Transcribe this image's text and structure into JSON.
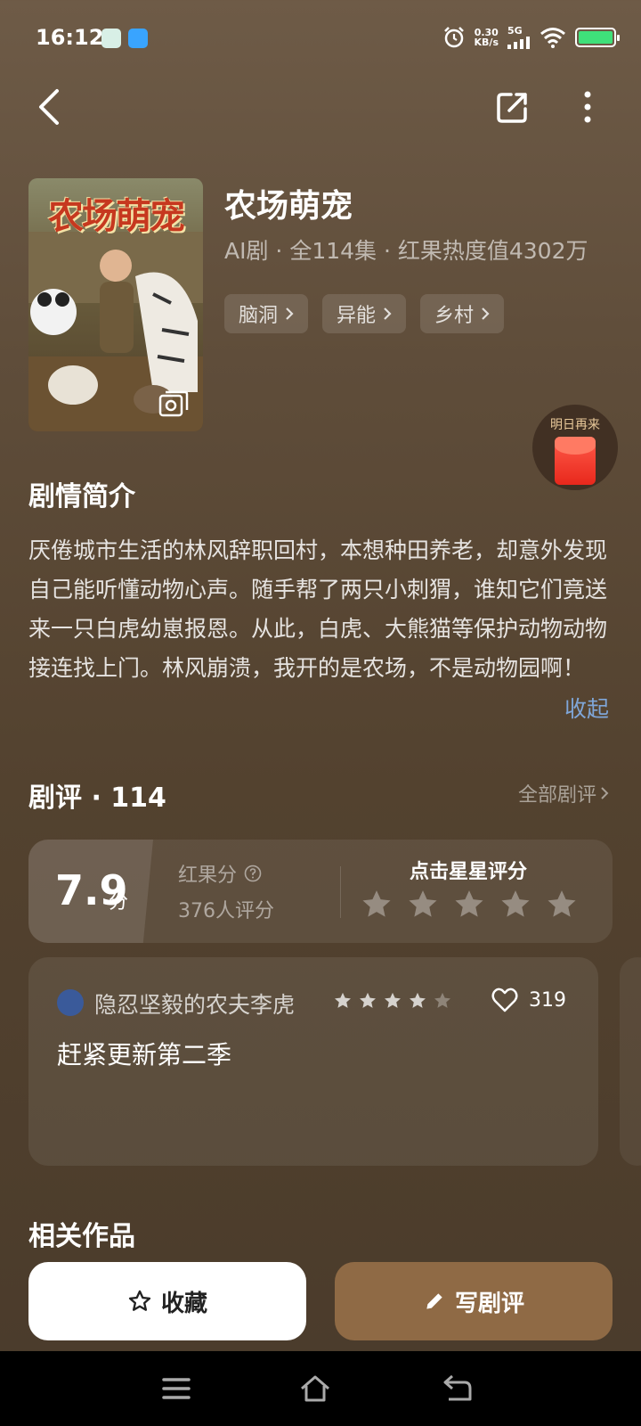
{
  "status_bar": {
    "time": "16:12",
    "speed_value": "0.30",
    "speed_unit": "KB/s",
    "network": "5G",
    "battery_level": 1.0,
    "battery_color": "#3fe07a"
  },
  "show": {
    "title": "农场萌宠",
    "poster_title": "农场萌宠",
    "meta": "AI剧 · 全114集 · 红果热度值4302万",
    "tags": [
      "脑洞",
      "异能",
      "乡村"
    ]
  },
  "reward": {
    "label": "明日再来"
  },
  "synopsis": {
    "heading": "剧情简介",
    "text": "厌倦城市生活的林风辞职回村，本想种田养老，却意外发现自己能听懂动物心声。随手帮了两只小刺猬，谁知它们竟送来一只白虎幼崽报恩。从此，白虎、大熊猫等保护动物动物接连找上门。林风崩溃，我开的是农场，不是动物园啊！",
    "collapse_label": "收起"
  },
  "reviews": {
    "heading": "剧评 · 114",
    "all_label": "全部剧评",
    "score": "7.9",
    "score_unit": "分",
    "score_label": "红果分",
    "rating_count": "376人评分",
    "rate_prompt": "点击星星评分",
    "rate_stars_total": 5,
    "comment": {
      "user": "隐忍坚毅的农夫李虎",
      "stars": 4,
      "stars_total": 5,
      "likes": "319",
      "text": "赶紧更新第二季"
    }
  },
  "related": {
    "heading": "相关作品"
  },
  "actions": {
    "favorite_label": "收藏",
    "write_review_label": "写剧评"
  },
  "colors": {
    "accent_link": "#7fa6d8",
    "write_button": "#8f6a45",
    "envelope": "#e8281c"
  }
}
